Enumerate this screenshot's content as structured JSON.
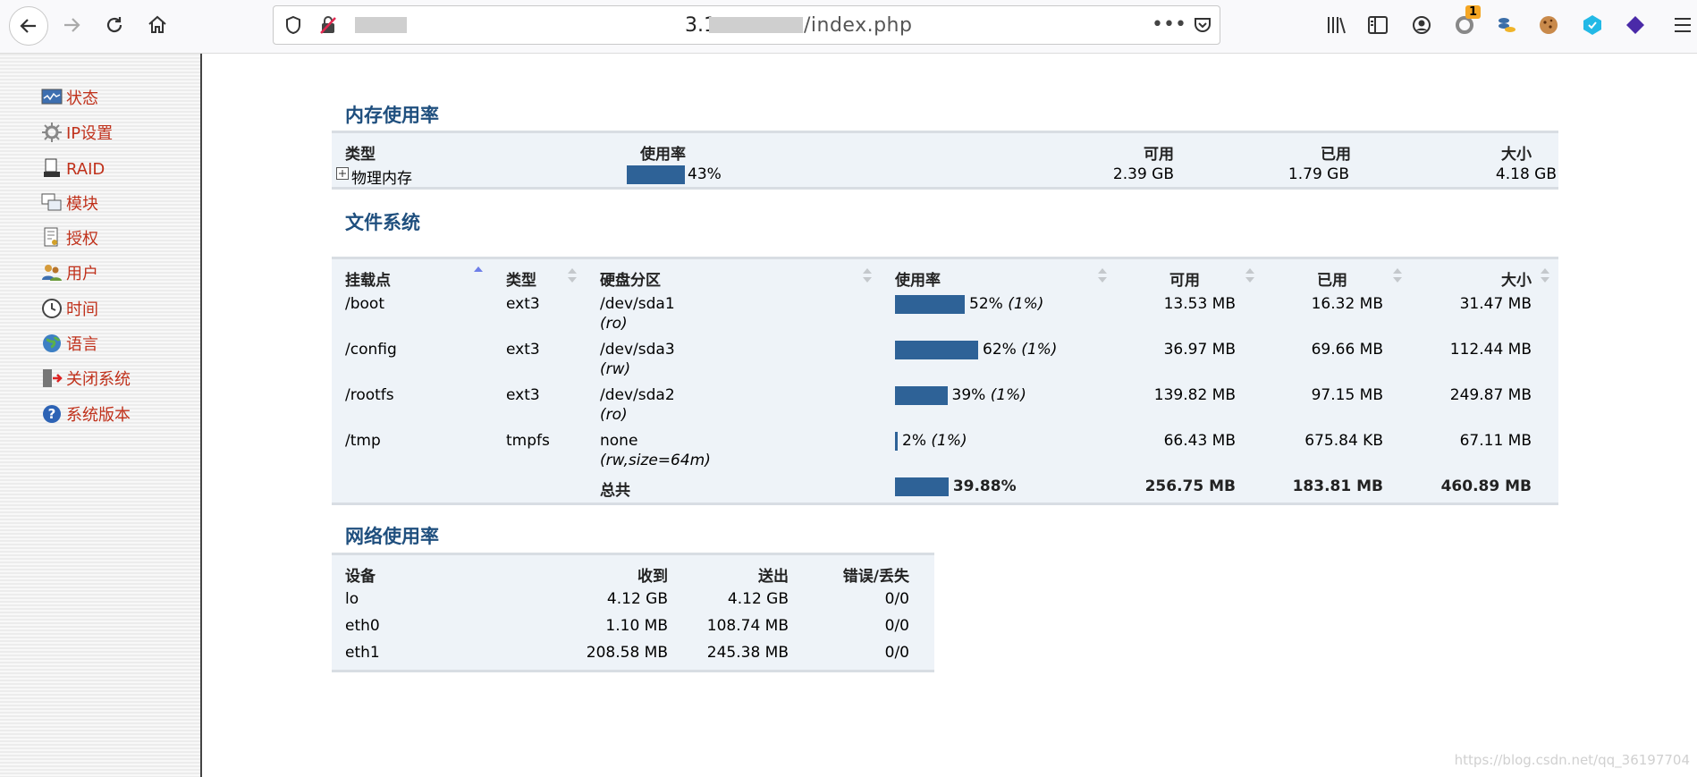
{
  "browser": {
    "url_visible_prefix": "3.1",
    "url_visible_suffix": "/index.php",
    "extension_badge": "1"
  },
  "sidebar": {
    "items": [
      {
        "label": "状态"
      },
      {
        "label": "IP设置"
      },
      {
        "label": "RAID"
      },
      {
        "label": "模块"
      },
      {
        "label": "授权"
      },
      {
        "label": "用户"
      },
      {
        "label": "时间"
      },
      {
        "label": "语言"
      },
      {
        "label": "关闭系统"
      },
      {
        "label": "系统版本"
      }
    ]
  },
  "memory": {
    "title": "内存使用率",
    "headers": {
      "type": "类型",
      "usage": "使用率",
      "free": "可用",
      "used": "已用",
      "size": "大小"
    },
    "row": {
      "type": "物理内存",
      "percent": "43%",
      "percent_value": 43,
      "free": "2.39 GB",
      "used": "1.79 GB",
      "size": "4.18 GB"
    }
  },
  "filesystem": {
    "title": "文件系统",
    "headers": {
      "mount": "挂载点",
      "type": "类型",
      "partition": "硬盘分区",
      "usage": "使用率",
      "free": "可用",
      "used": "已用",
      "size": "大小"
    },
    "rows": [
      {
        "mount": "/boot",
        "type": "ext3",
        "partition": "/dev/sda1",
        "opts": "(ro)",
        "percent": "52%",
        "inodes": "(1%)",
        "percent_value": 52,
        "free": "13.53 MB",
        "used": "16.32 MB",
        "size": "31.47 MB"
      },
      {
        "mount": "/config",
        "type": "ext3",
        "partition": "/dev/sda3",
        "opts": "(rw)",
        "percent": "62%",
        "inodes": "(1%)",
        "percent_value": 62,
        "free": "36.97 MB",
        "used": "69.66 MB",
        "size": "112.44 MB"
      },
      {
        "mount": "/rootfs",
        "type": "ext3",
        "partition": "/dev/sda2",
        "opts": "(ro)",
        "percent": "39%",
        "inodes": "(1%)",
        "percent_value": 39,
        "free": "139.82 MB",
        "used": "97.15 MB",
        "size": "249.87 MB"
      },
      {
        "mount": "/tmp",
        "type": "tmpfs",
        "partition": "none",
        "opts": "(rw,size=64m)",
        "percent": "2%",
        "inodes": "(1%)",
        "percent_value": 2,
        "free": "66.43 MB",
        "used": "675.84 KB",
        "size": "67.11 MB"
      }
    ],
    "total": {
      "label": "总共",
      "percent": "39.88%",
      "percent_value": 39.88,
      "free": "256.75 MB",
      "used": "183.81 MB",
      "size": "460.89 MB"
    }
  },
  "network": {
    "title": "网络使用率",
    "headers": {
      "device": "设备",
      "received": "收到",
      "sent": "送出",
      "errors": "错误/丢失"
    },
    "rows": [
      {
        "device": "lo",
        "received": "4.12 GB",
        "sent": "4.12 GB",
        "errors": "0/0"
      },
      {
        "device": "eth0",
        "received": "1.10 MB",
        "sent": "108.74 MB",
        "errors": "0/0"
      },
      {
        "device": "eth1",
        "received": "208.58 MB",
        "sent": "245.38 MB",
        "errors": "0/0"
      }
    ]
  },
  "watermark": "https://blog.csdn.net/qq_36197704",
  "colors": {
    "accent_blue": "#2e6297",
    "menu_red": "#c0311b",
    "title_blue": "#1f4f7e"
  }
}
